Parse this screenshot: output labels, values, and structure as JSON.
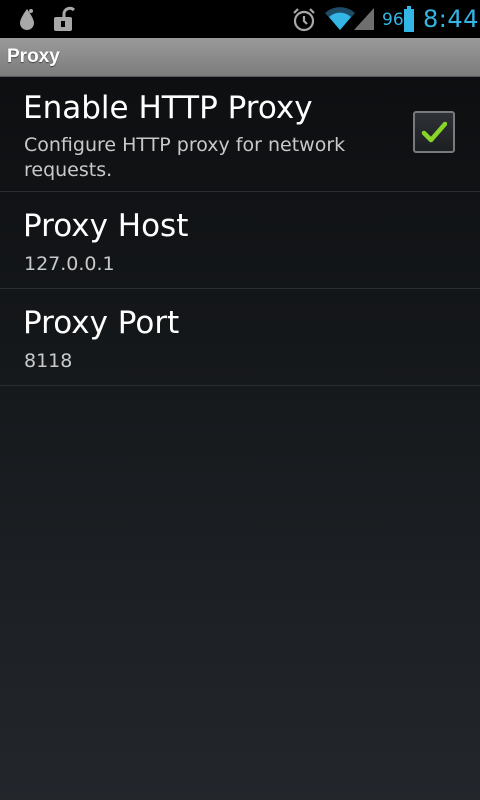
{
  "status_bar": {
    "battery_percent": "96",
    "time": "8:44",
    "accent_color": "#33b5e5",
    "icons": [
      "notification-drop-icon",
      "unlock-icon",
      "alarm-icon",
      "wifi-icon",
      "signal-icon",
      "battery-icon"
    ]
  },
  "title_bar": {
    "title": "Proxy"
  },
  "preferences": [
    {
      "title": "Enable HTTP Proxy",
      "summary": "Configure HTTP proxy for network requests.",
      "checked": true
    },
    {
      "title": "Proxy Host",
      "summary": "127.0.0.1"
    },
    {
      "title": "Proxy Port",
      "summary": "8118"
    }
  ],
  "colors": {
    "checkmark": "#8ad42a",
    "title_bar_bg": "#8a8a8a"
  }
}
